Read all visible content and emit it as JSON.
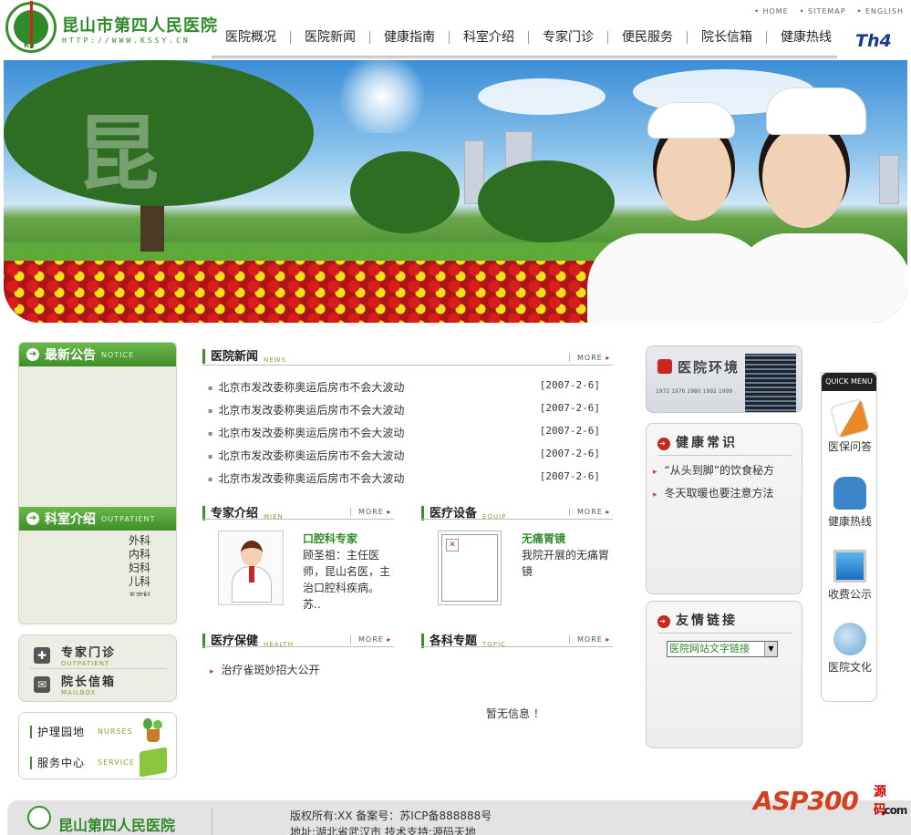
{
  "header": {
    "hospital_name": "昆山市第四人民医院",
    "website": "HTTP://WWW.KSSY.CN",
    "logo_letters": "KS",
    "top_links": [
      "HOME",
      "SITEMAP",
      "ENGLISH"
    ],
    "nav": [
      "医院概况",
      "医院新闻",
      "健康指南",
      "科室介绍",
      "专家门诊",
      "便民服务",
      "院长信箱",
      "健康热线"
    ],
    "badge": "Th4"
  },
  "banner": {
    "watermark": "昆"
  },
  "left": {
    "notice": {
      "title": "最新公告",
      "en": "NOTICE"
    },
    "outpatient": {
      "title": "科室介绍",
      "en": "OUTPATIENT",
      "depts": [
        "外科",
        "内科",
        "妇科",
        "儿科",
        "五官科"
      ]
    },
    "quick_links": [
      {
        "title": "专家门诊",
        "en": "OUTPATIENT",
        "icon": "plus-icon"
      },
      {
        "title": "院长信箱",
        "en": "MAILBOX",
        "icon": "mail-icon"
      }
    ],
    "nurse_links": [
      {
        "title": "护理园地",
        "en": "NURSES",
        "icon": "plant-icon"
      },
      {
        "title": "服务中心",
        "en": "SERVICE",
        "icon": "box-icon"
      }
    ]
  },
  "center": {
    "news": {
      "title": "医院新闻",
      "en": "NEWS",
      "more": "MORE",
      "items": [
        {
          "text": "北京市发改委称奥运后房市不会大波动",
          "date": "[2007-2-6]"
        },
        {
          "text": "北京市发改委称奥运后房市不会大波动",
          "date": "[2007-2-6]"
        },
        {
          "text": "北京市发改委称奥运后房市不会大波动",
          "date": "[2007-2-6]"
        },
        {
          "text": "北京市发改委称奥运后房市不会大波动",
          "date": "[2007-2-6]"
        },
        {
          "text": "北京市发改委称奥运后房市不会大波动",
          "date": "[2007-2-6]"
        }
      ]
    },
    "expert": {
      "title": "专家介绍",
      "en": "MIEN",
      "more": "MORE",
      "name": "口腔科专家",
      "desc": [
        "顾圣祖：主任医",
        "师，昆山名医，主",
        "治口腔科疾病。",
        "苏.."
      ]
    },
    "equip": {
      "title": "医疗设备",
      "en": "EQUIP",
      "more": "MORE",
      "name": "无痛胃镜",
      "desc": [
        "我院开展的无痛胃",
        "镜"
      ]
    },
    "health": {
      "title": "医疗保健",
      "en": "HEALTH",
      "more": "MORE",
      "items": [
        "治疗雀斑妙招大公开"
      ]
    },
    "topic": {
      "title": "各科专题",
      "en": "TOPIC",
      "more": "MORE",
      "empty": "暂无信息 ！"
    }
  },
  "right": {
    "environment": {
      "title": "医院环境",
      "years": [
        "1972",
        "1976",
        "1980",
        "1992",
        "1999"
      ]
    },
    "health_tips": {
      "title": "健康常识",
      "items": [
        "“从头到脚”的饮食秘方",
        "冬天取暖也要注意方法"
      ]
    },
    "links": {
      "title": "友情链接",
      "select_value": "医院网站文字链接"
    }
  },
  "quick_menu": {
    "title": "QUICK MENU",
    "items": [
      {
        "label": "医保问答",
        "icon": "document-icon"
      },
      {
        "label": "健康热线",
        "icon": "phone-icon"
      },
      {
        "label": "收费公示",
        "icon": "monitor-icon"
      },
      {
        "label": "医院文化",
        "icon": "culture-icon"
      }
    ]
  },
  "footer": {
    "hospital_name": "昆山第四人民医院",
    "copyright": "版权所有:XX 备案号：苏ICP备888888号",
    "address": "地址:湖北省武汉市    技术支持:源码天地"
  },
  "watermark": {
    "text": "ASP300",
    "suffix": "源码",
    "domain": ".com"
  },
  "colors": {
    "brand_green": "#2f8a2a",
    "accent_red": "#c8261e",
    "nav_text": "#222222"
  }
}
